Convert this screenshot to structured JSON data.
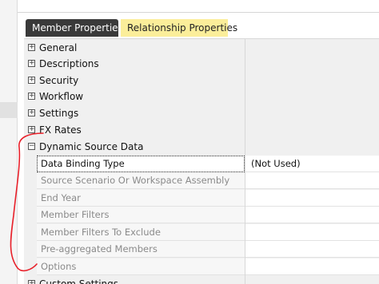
{
  "tabs": {
    "member_properties": "Member Properties",
    "relationship_properties": "Relationship Properties"
  },
  "categories": [
    {
      "expander": "+",
      "label": "General"
    },
    {
      "expander": "+",
      "label": "Descriptions"
    },
    {
      "expander": "+",
      "label": "Security"
    },
    {
      "expander": "+",
      "label": "Workflow"
    },
    {
      "expander": "+",
      "label": "Settings"
    },
    {
      "expander": "+",
      "label": "FX Rates"
    },
    {
      "expander": "−",
      "label": "Dynamic Source Data"
    }
  ],
  "dynamic_source_data": [
    {
      "name": "Data Binding Type",
      "value": "(Not Used)"
    },
    {
      "name": "Source Scenario Or Workspace Assembly",
      "value": ""
    },
    {
      "name": "End Year",
      "value": ""
    },
    {
      "name": "Member Filters",
      "value": ""
    },
    {
      "name": "Member Filters To Exclude",
      "value": ""
    },
    {
      "name": "Pre-aggregated Members",
      "value": ""
    },
    {
      "name": "Options",
      "value": ""
    }
  ],
  "next_category": {
    "expander": "+",
    "label": "Custom Settings"
  },
  "colors": {
    "active_tab": "#3a3a3a",
    "inactive_tab": "#fbee9a",
    "annotation": "#e8202a"
  }
}
